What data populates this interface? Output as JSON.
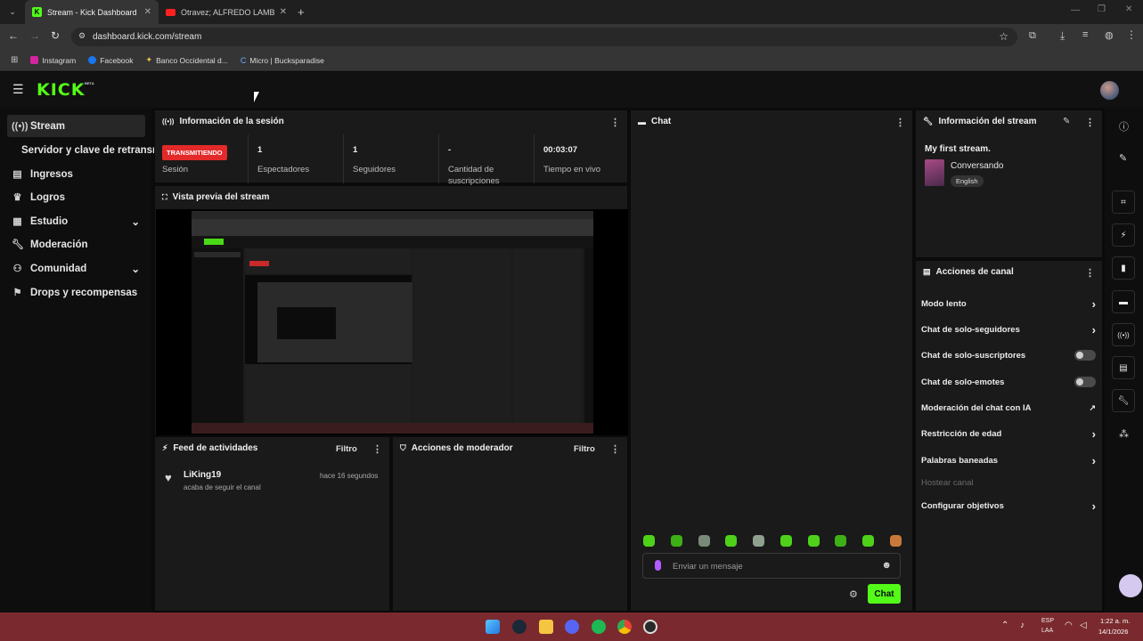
{
  "browser": {
    "tabs": [
      {
        "title": "Stream - Kick Dashboard",
        "active": true
      },
      {
        "title": "Otravez; ALFREDO LAMBEZUEL",
        "active": false
      }
    ],
    "url": "dashboard.kick.com/stream",
    "bookmarks": [
      "Instagram",
      "Facebook",
      "Banco Occidental d...",
      "Micro | Bucksparadise"
    ]
  },
  "app": {
    "logo": "KICK",
    "logo_badge": "BETA"
  },
  "sidebar": {
    "items": [
      {
        "label": "Stream",
        "icon": "broadcast-icon"
      },
      {
        "label": "Servidor y clave de retransmisión",
        "icon": ""
      },
      {
        "label": "Ingresos",
        "icon": "chart-icon"
      },
      {
        "label": "Logros",
        "icon": "trophy-icon"
      },
      {
        "label": "Estudio",
        "icon": "grid-icon"
      },
      {
        "label": "Moderación",
        "icon": "wrench-icon"
      },
      {
        "label": "Comunidad",
        "icon": "people-icon"
      },
      {
        "label": "Drops y recompensas",
        "icon": "gift-icon"
      }
    ]
  },
  "session": {
    "title": "Información de la sesión",
    "badge": "TRANSMITIENDO",
    "badge_label": "Sesión",
    "stats": [
      {
        "value": "1",
        "label": "Espectadores"
      },
      {
        "value": "1",
        "label": "Seguidores"
      },
      {
        "value": "-",
        "label": "Cantidad de suscripciones"
      },
      {
        "value": "00:03:07",
        "label": "Tiempo en vivo"
      }
    ]
  },
  "preview": {
    "title": "Vista previa del stream"
  },
  "activity": {
    "title": "Feed de actividades",
    "filter": "Filtro",
    "items": [
      {
        "user": "LiKing19",
        "text": "acaba de seguir el canal",
        "time": "hace 16 segundos"
      }
    ]
  },
  "modactions": {
    "title": "Acciones de moderador",
    "filter": "Filtro"
  },
  "chat": {
    "title": "Chat",
    "placeholder": "Enviar un mensaje",
    "send_label": "Chat"
  },
  "stream_info": {
    "title": "Información del stream",
    "stream_title": "My first stream.",
    "category": "Conversando",
    "language": "English"
  },
  "channel_actions": {
    "title": "Acciones de canal",
    "items": [
      {
        "label": "Modo lento",
        "control": "chevron"
      },
      {
        "label": "Chat de solo-seguidores",
        "control": "chevron"
      },
      {
        "label": "Chat de solo-suscriptores",
        "control": "toggle"
      },
      {
        "label": "Chat de solo-emotes",
        "control": "toggle"
      },
      {
        "label": "Moderación del chat con IA",
        "control": "external"
      },
      {
        "label": "Restricción de edad",
        "control": "chevron"
      },
      {
        "label": "Palabras baneadas",
        "control": "chevron"
      },
      {
        "label": "Hostear canal",
        "control": "none"
      },
      {
        "label": "Configurar objetivos",
        "control": "chevron"
      }
    ]
  },
  "taskbar": {
    "lang": "ESP",
    "lang2": "LAA",
    "time": "1:22 a. m.",
    "date": "14/1/2026"
  },
  "colors": {
    "brand": "#53fc18",
    "live": "#e32a2a",
    "taskbar": "#7a2a2e"
  }
}
